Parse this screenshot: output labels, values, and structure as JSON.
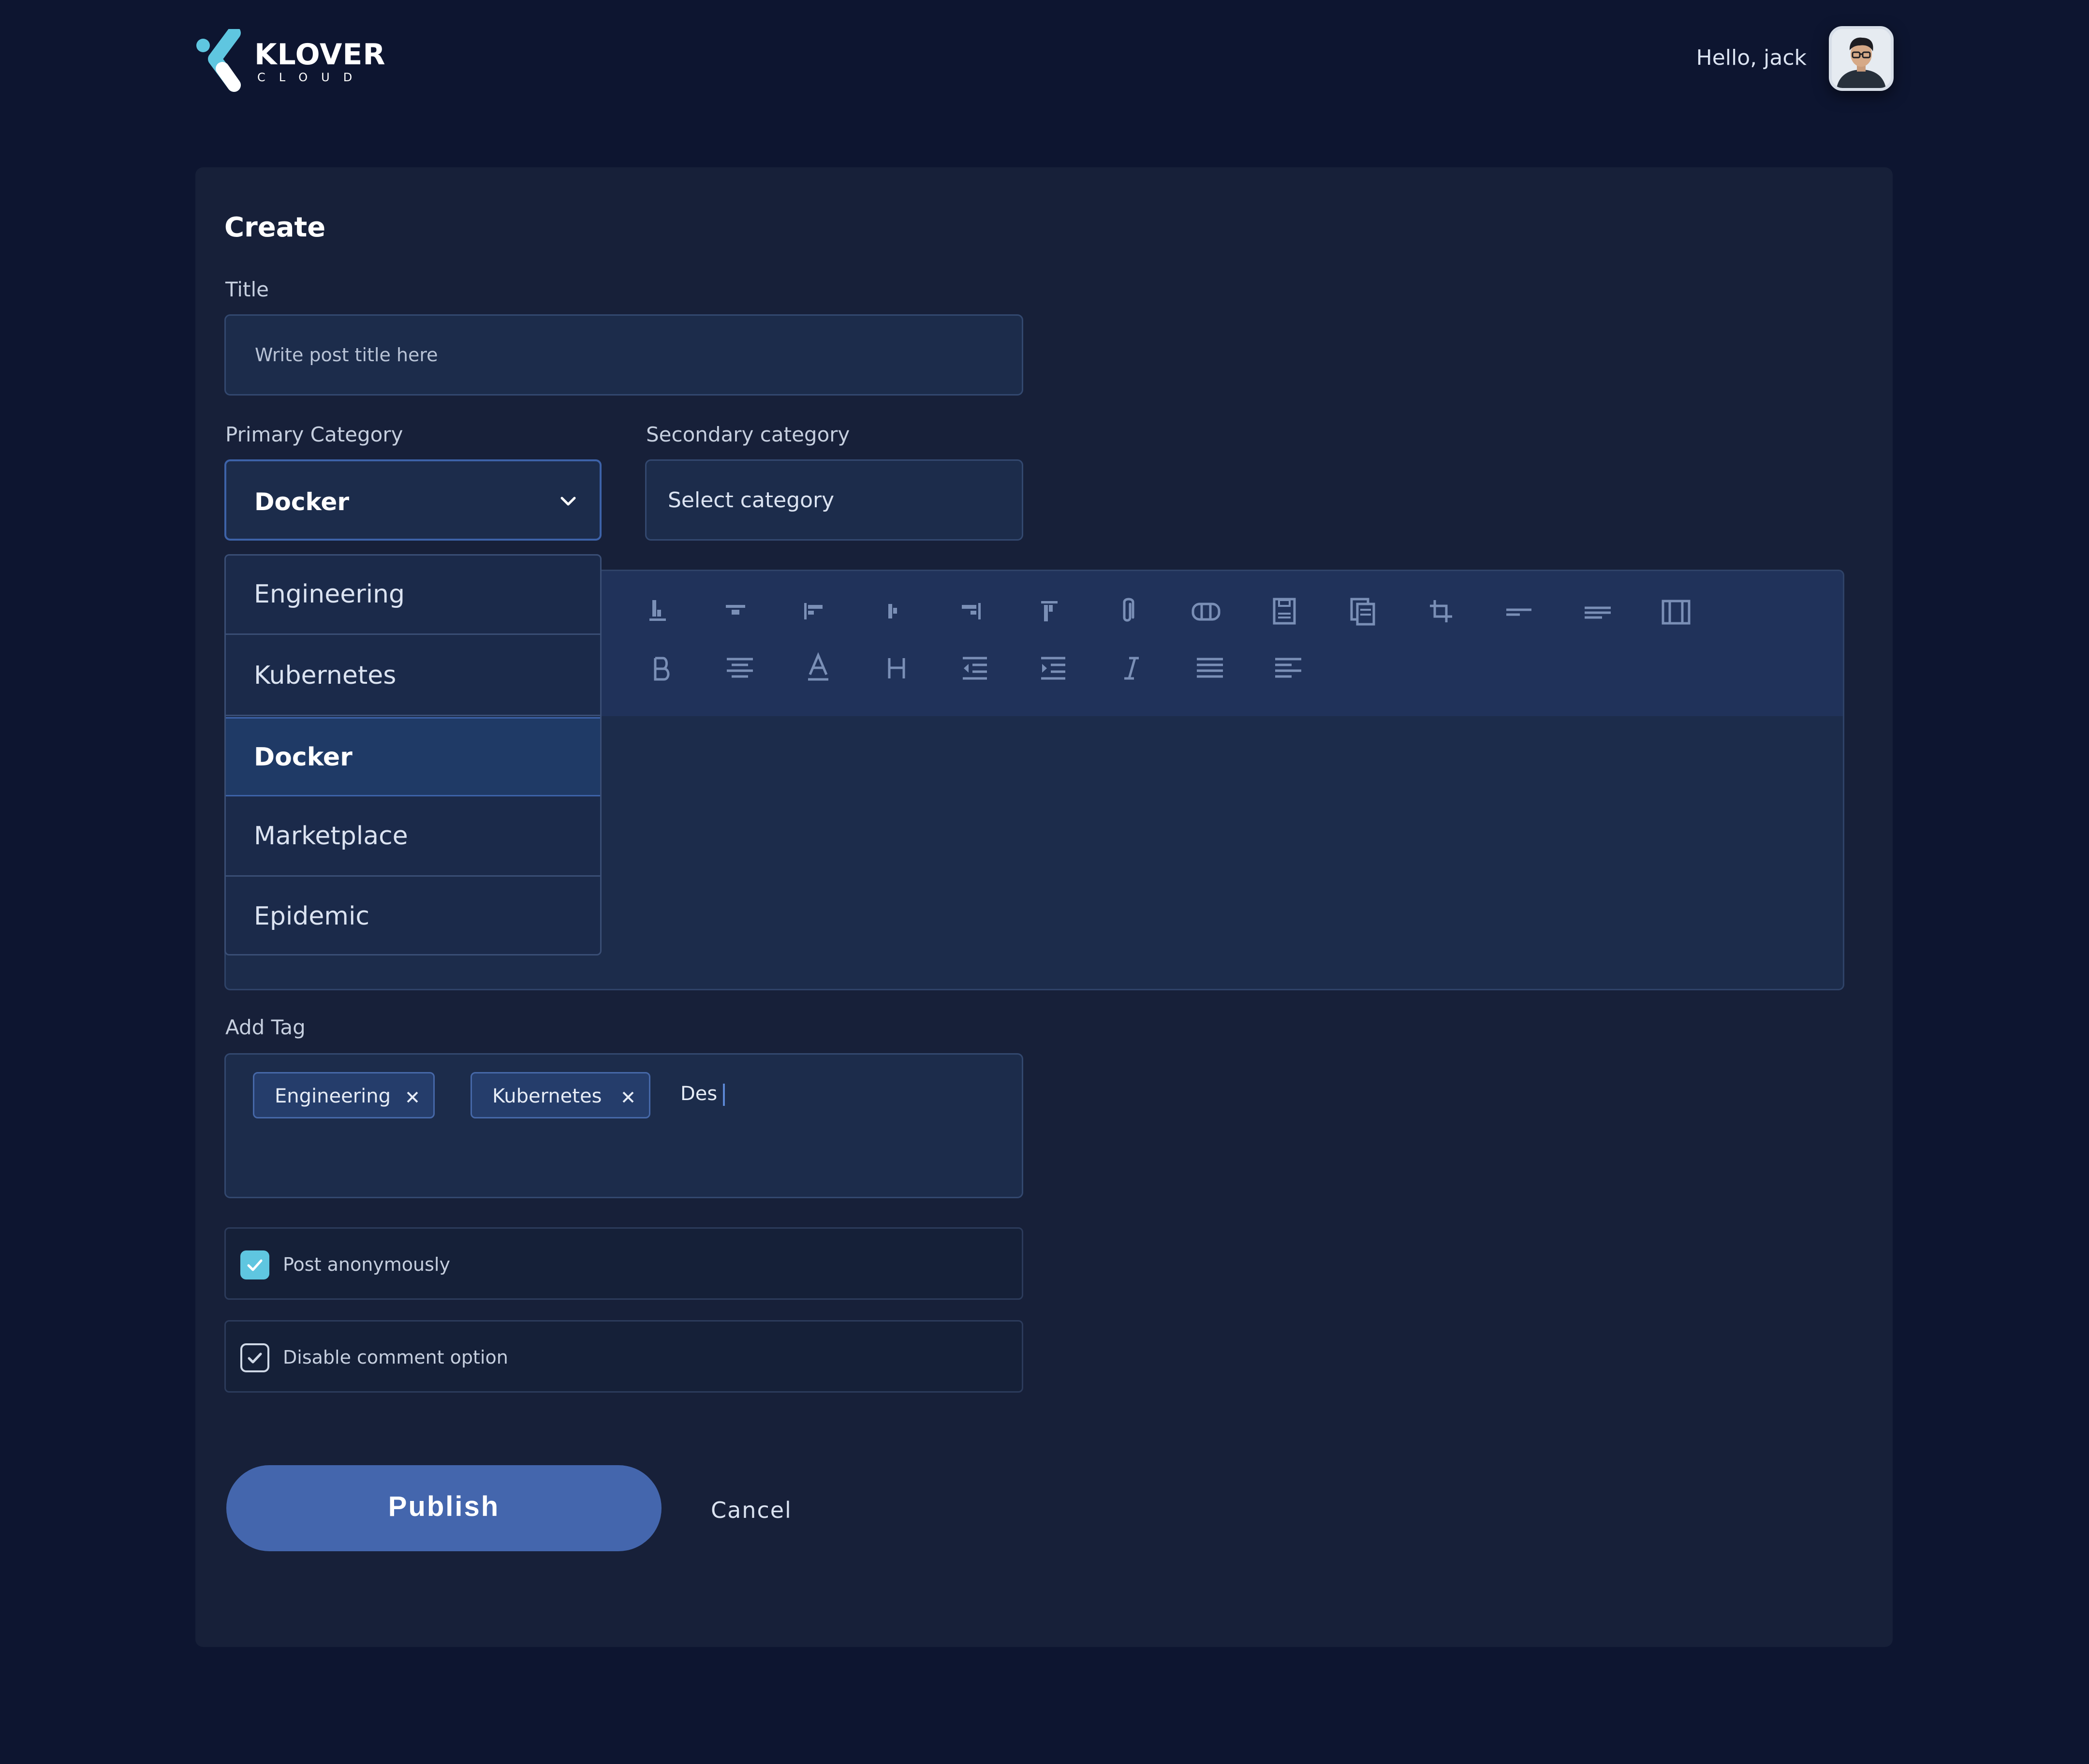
{
  "header": {
    "brand": "KLOVER",
    "brand_sub": "CLOUD",
    "greeting": "Hello, jack"
  },
  "form": {
    "heading": "Create",
    "title_label": "Title",
    "title_placeholder": "Write post title here",
    "primary_label": "Primary Category",
    "primary_value": "Docker",
    "secondary_label": "Secondary category",
    "secondary_value": "Select category",
    "dropdown_options": [
      "Engineering",
      "Kubernetes",
      "Docker",
      "Marketplace",
      "Epidemic"
    ],
    "selected_option": "Docker",
    "tag_label": "Add Tag",
    "tags": [
      "Engineering",
      "Kubernetes"
    ],
    "tag_input_value": "Des",
    "anonymous_label": "Post anonymously",
    "anonymous_checked": true,
    "disable_comments_label": "Disable comment option",
    "disable_comments_checked": true,
    "publish_label": "Publish",
    "cancel_label": "Cancel"
  },
  "toolbar": {
    "row1": [
      "align-bottom-icon",
      "align-vertical-center-icon",
      "align-left-edge-icon",
      "align-horizontal-center-icon",
      "align-right-edge-icon",
      "align-top-icon",
      "attachment-icon",
      "columns-icon",
      "save-icon",
      "copy-icon",
      "crop-icon",
      "horizontal-rule-icon",
      "text-short-icon",
      "frame-icon"
    ],
    "row2": [
      "bold-icon",
      "align-center-icon",
      "text-color-icon",
      "heading-icon",
      "indent-decrease-icon",
      "indent-increase-icon",
      "italic-icon",
      "justify-icon",
      "align-left-icon"
    ]
  },
  "colors": {
    "background": "#0d1530",
    "card": "#172039",
    "accent": "#4466ad",
    "check": "#5fc6e0"
  }
}
